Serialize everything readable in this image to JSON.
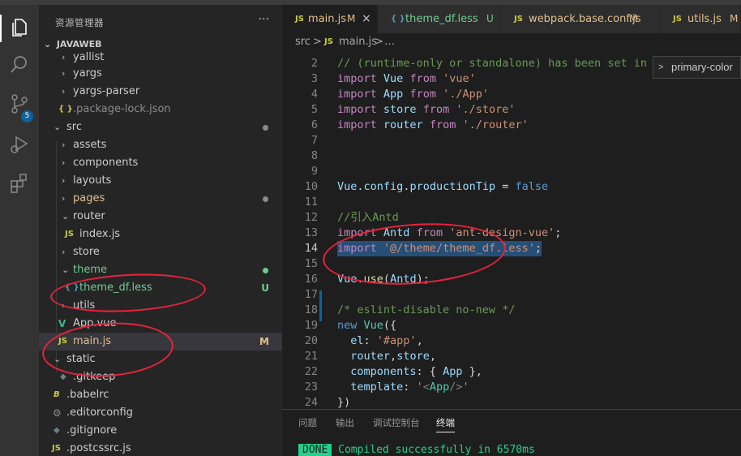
{
  "sidebar": {
    "header": "资源管理器",
    "more_label": "···",
    "section_title": "JAVAWEB",
    "tree": [
      {
        "name": "yallist",
        "type": "folder"
      },
      {
        "name": "yargs",
        "type": "folder"
      },
      {
        "name": "yargs-parser",
        "type": "folder"
      },
      {
        "name": ".package-lock.json",
        "type": "json",
        "icon": "{ }"
      },
      {
        "name": "src",
        "type": "folder-open"
      },
      {
        "name": "assets",
        "type": "folder"
      },
      {
        "name": "components",
        "type": "folder"
      },
      {
        "name": "layouts",
        "type": "folder"
      },
      {
        "name": "pages",
        "type": "folder"
      },
      {
        "name": "router",
        "type": "folder-open"
      },
      {
        "name": "index.js",
        "type": "js",
        "icon": "JS"
      },
      {
        "name": "store",
        "type": "folder"
      },
      {
        "name": "theme",
        "type": "folder-open"
      },
      {
        "name": "theme_df.less",
        "type": "less",
        "icon": "{ }",
        "status": "U"
      },
      {
        "name": "utils",
        "type": "folder"
      },
      {
        "name": "App.vue",
        "type": "vue",
        "icon": "V"
      },
      {
        "name": "main.js",
        "type": "js",
        "icon": "JS",
        "status": "M"
      },
      {
        "name": "static",
        "type": "folder-open"
      },
      {
        "name": ".gitkeep",
        "type": "file",
        "icon": "◆"
      },
      {
        "name": ".babelrc",
        "type": "babel",
        "icon": "B"
      },
      {
        "name": ".editorconfig",
        "type": "config",
        "icon": "⚙"
      },
      {
        "name": ".gitignore",
        "type": "git",
        "icon": "◆"
      },
      {
        "name": ".postcssrc.js",
        "type": "js",
        "icon": "JS"
      }
    ]
  },
  "activity": {
    "badge": "5",
    "icons": [
      "explorer-icon",
      "search-icon",
      "source-control-icon",
      "run-debug-icon",
      "extensions-icon"
    ]
  },
  "tabs": [
    {
      "icon": "JS",
      "label": "main.js",
      "status": "M",
      "close": "×"
    },
    {
      "icon": "{ }",
      "label": "theme_df.less",
      "status": "U"
    },
    {
      "icon": "JS",
      "label": "webpack.base.conf.js",
      "status": "M"
    },
    {
      "icon": "JS",
      "label": "utils.js",
      "status": "M"
    }
  ],
  "breadcrumb": {
    "folder": "src",
    "sep": ">",
    "icon": "JS",
    "file": "main.js",
    "sep2": ">",
    "more": "…"
  },
  "hover": {
    "chevron": ">",
    "label": "primary-color"
  },
  "code": [
    {
      "n": "2",
      "t": "// (runtime-only or standalone) has been set in webp"
    },
    {
      "n": "3",
      "t": "import Vue from 'vue'"
    },
    {
      "n": "4",
      "t": "import App from './App'"
    },
    {
      "n": "5",
      "t": "import store from './store'"
    },
    {
      "n": "6",
      "t": "import router from './router'"
    },
    {
      "n": "7",
      "t": ""
    },
    {
      "n": "8",
      "t": ""
    },
    {
      "n": "9",
      "t": ""
    },
    {
      "n": "10",
      "t": "Vue.config.productionTip = false"
    },
    {
      "n": "11",
      "t": ""
    },
    {
      "n": "12",
      "t": "//引入Antd"
    },
    {
      "n": "13",
      "t": "import Antd from 'ant-design-vue';"
    },
    {
      "n": "14",
      "t": "import '@/theme/theme_df.less';"
    },
    {
      "n": "15",
      "t": ""
    },
    {
      "n": "16",
      "t": "Vue.use(Antd);"
    },
    {
      "n": "17",
      "t": ""
    },
    {
      "n": "18",
      "t": "/* eslint-disable no-new */"
    },
    {
      "n": "19",
      "t": "new Vue({"
    },
    {
      "n": "20",
      "t": "  el: '#app',"
    },
    {
      "n": "21",
      "t": "  router,store,"
    },
    {
      "n": "22",
      "t": "  components: { App },"
    },
    {
      "n": "23",
      "t": "  template: '<App/>'"
    },
    {
      "n": "24",
      "t": "})"
    }
  ],
  "panel": {
    "tabs": [
      "问题",
      "输出",
      "调试控制台",
      "终端"
    ],
    "active_tab": "终端",
    "done_label": "DONE",
    "message": "Compiled successfully in 6570ms"
  },
  "colors": {
    "keyword": "#569cd6",
    "keyword_control": "#c586c0",
    "variable": "#9cdcfe",
    "string": "#ce9178",
    "comment": "#6a9955",
    "modified": "#e2c08d",
    "untracked": "#73c991",
    "js_icon": "#cbcb41",
    "vue_icon": "#41b883",
    "annotation": "#e8233b"
  }
}
